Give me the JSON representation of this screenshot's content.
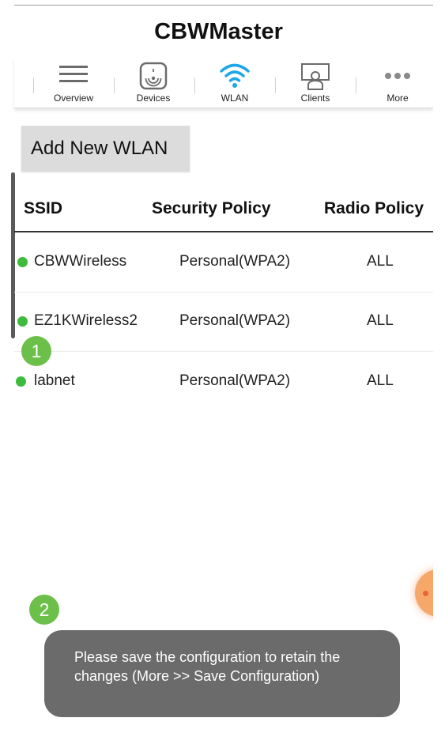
{
  "app": {
    "title": "CBWMaster"
  },
  "nav": {
    "items": [
      {
        "label": "Overview",
        "icon": "menu-icon"
      },
      {
        "label": "Devices",
        "icon": "access-point-icon"
      },
      {
        "label": "WLAN",
        "icon": "wifi-icon",
        "active": true
      },
      {
        "label": "Clients",
        "icon": "clients-icon"
      },
      {
        "label": "More",
        "icon": "more-dots-icon"
      }
    ],
    "active_color": "#1ea7e8"
  },
  "actions": {
    "add_wlan_label": "Add New WLAN"
  },
  "table": {
    "columns": [
      "SSID",
      "Security Policy",
      "Radio Policy"
    ],
    "rows": [
      {
        "ssid": "CBWWireless",
        "security": "Personal(WPA2)",
        "radio": "ALL",
        "status_color": "#3dbb3d"
      },
      {
        "ssid": "EZ1KWireless2",
        "security": "Personal(WPA2)",
        "radio": "ALL",
        "status_color": "#3dbb3d"
      },
      {
        "ssid": "labnet",
        "security": "Personal(WPA2)",
        "radio": "ALL",
        "status_color": "#3dbb3d"
      }
    ]
  },
  "badges": {
    "step1": "1",
    "step2": "2",
    "color": "#6cc04a"
  },
  "toast": {
    "message": "Please save the configuration to retain the changes (More >> Save Configuration)"
  }
}
